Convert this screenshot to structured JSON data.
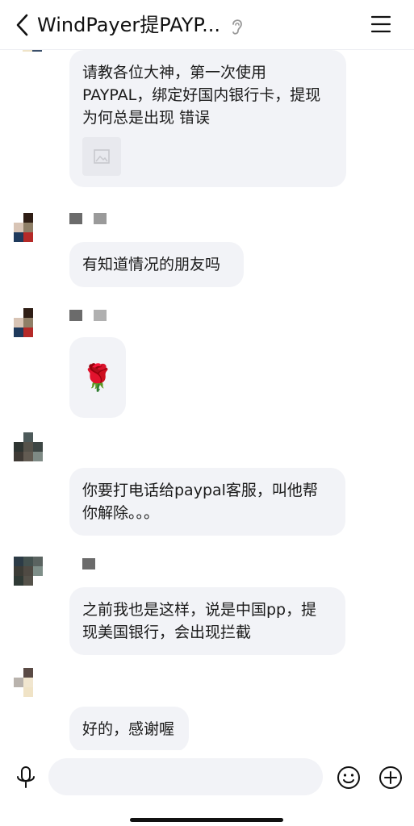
{
  "header": {
    "title": "WindPayer提PAYP...",
    "back_icon": "chevron-left-icon",
    "ear_icon": "ear-icon",
    "menu_icon": "hamburger-menu-icon"
  },
  "messages": [
    {
      "text": "请教各位大神，第一次使用\nPAYPAL，绑定好国内银行卡，提现\n为何总是出现 错误",
      "has_image": true
    },
    {
      "text": "有知道情况的朋友吗"
    },
    {
      "text": "🌹"
    },
    {
      "text": "你要打电话给paypal客服，叫他帮\n你解除。。。"
    },
    {
      "text": "之前我也是这样，说是中国pp，提\n现美国银行，会出现拦截"
    },
    {
      "text": "好的，感谢喔"
    }
  ],
  "input": {
    "mic_icon": "microphone-icon",
    "emoji_icon": "emoji-icon",
    "plus_icon": "plus-icon"
  },
  "colors": {
    "bubble": "#f2f3f7",
    "background": "#ffffff"
  }
}
